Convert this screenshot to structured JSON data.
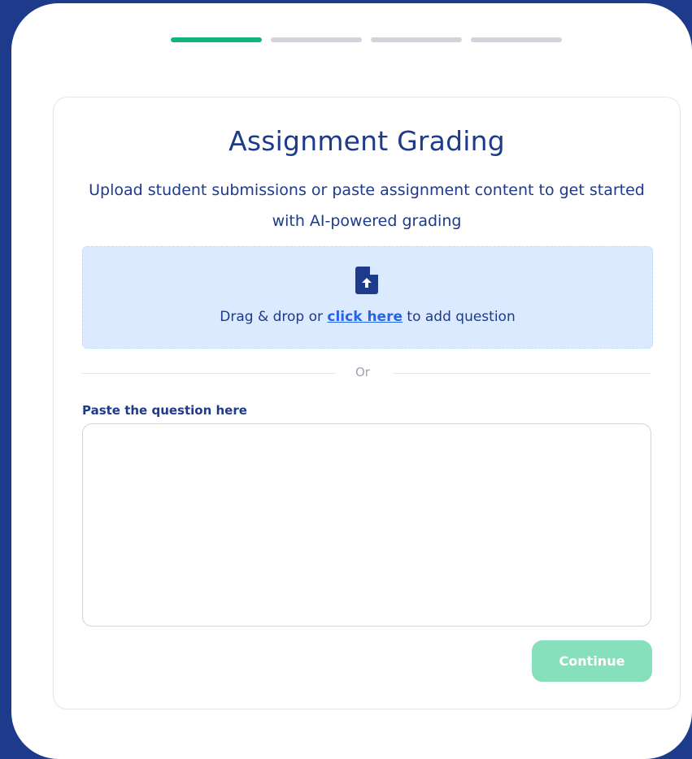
{
  "stepper": {
    "total_steps": 4,
    "current_step": 1,
    "active_color": "#16b37a",
    "inactive_color": "#d1d5db"
  },
  "card": {
    "title": "Assignment Grading",
    "subtitle": "Upload student submissions or paste assignment content to get started with AI-powered grading"
  },
  "dropzone": {
    "icon": "file-upload-icon",
    "text_before": "Drag & drop or ",
    "link_text": "click here",
    "text_after": " to add question"
  },
  "divider": {
    "text": "Or"
  },
  "paste": {
    "label": "Paste the question here",
    "value": "",
    "placeholder": ""
  },
  "actions": {
    "continue_label": "Continue"
  },
  "colors": {
    "page_background": "#1e3a8a",
    "primary_text": "#1e3a8a",
    "dropzone_background": "#dbeafe",
    "link": "#2563eb",
    "button_disabled": "#86e0bc"
  }
}
